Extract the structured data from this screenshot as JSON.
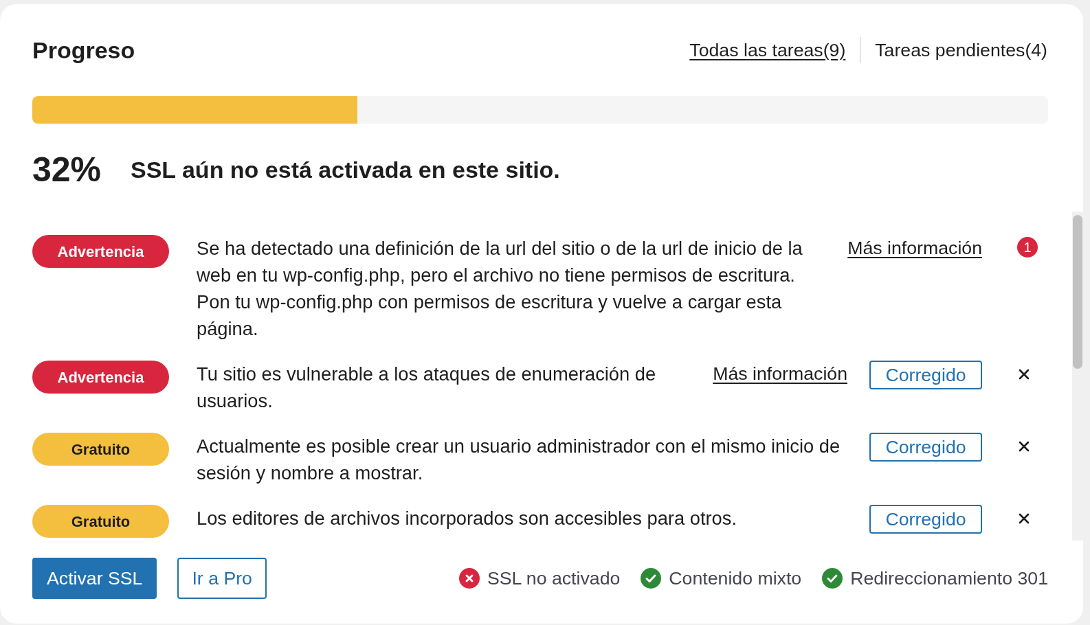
{
  "header": {
    "title": "Progreso",
    "tabs": [
      {
        "label": "Todas las tareas(9)",
        "selected": true
      },
      {
        "label": "Tareas pendientes(4)",
        "selected": false
      }
    ]
  },
  "progress": {
    "level": 0.32
  },
  "summary": {
    "percent": "32%",
    "message": "SSL aún no está activada en este sitio."
  },
  "tasks": [
    {
      "badge": {
        "label": "Advertencia",
        "kind": "warning"
      },
      "text": "Se ha detectado una definición de la url del sitio o de la url de inicio de la web en tu wp-config.php, pero el archivo no tiene permisos de escritura. Pon tu wp-config.php con permisos de escritura y vuelve a cargar esta página.",
      "link": "Más información",
      "count": "1",
      "dismissible": false
    },
    {
      "badge": {
        "label": "Advertencia",
        "kind": "warning"
      },
      "text": "Tu sitio es vulnerable a los ataques de enumeración de usuarios.",
      "link": "Más información",
      "action": "Corregido",
      "dismissible": true
    },
    {
      "badge": {
        "label": "Gratuito",
        "kind": "free"
      },
      "text": "Actualmente es posible crear un usuario administrador con el mismo inicio de sesión y nombre a mostrar.",
      "action": "Corregido",
      "dismissible": true
    },
    {
      "badge": {
        "label": "Gratuito",
        "kind": "free"
      },
      "text": "Los editores de archivos incorporados son accesibles para otros.",
      "action": "Corregido",
      "dismissible": true
    }
  ],
  "footer": {
    "buttons": [
      {
        "label": "Activar SSL",
        "kind": "primary"
      },
      {
        "label": "Ir a Pro",
        "kind": "secondary"
      }
    ],
    "statuses": [
      {
        "label": "SSL no activado",
        "passed": false
      },
      {
        "label": "Contenido mixto",
        "passed": true
      },
      {
        "label": "Redireccionamiento 301",
        "passed": true
      }
    ]
  }
}
